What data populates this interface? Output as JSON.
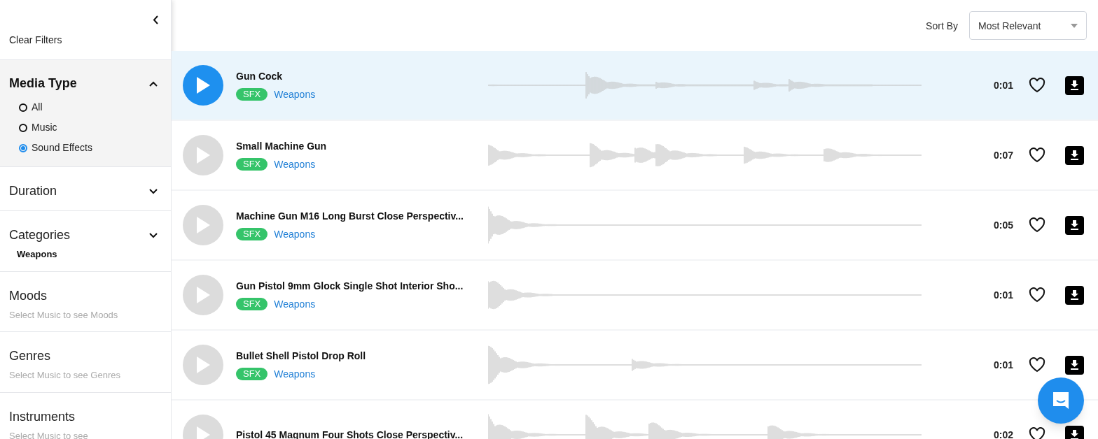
{
  "sidebar": {
    "clear_filters": "Clear Filters",
    "sections": [
      {
        "title": "Media Type",
        "expanded": true,
        "options": [
          {
            "label": "All",
            "selected": false
          },
          {
            "label": "Music",
            "selected": false
          },
          {
            "label": "Sound Effects",
            "selected": true
          }
        ]
      },
      {
        "title": "Duration",
        "expanded": false
      },
      {
        "title": "Categories",
        "expanded": false,
        "value": "Weapons"
      },
      {
        "title": "Moods",
        "hint": "Select Music to see Moods"
      },
      {
        "title": "Genres",
        "hint": "Select Music to see Genres"
      },
      {
        "title": "Instruments",
        "hint": "Select Music to see"
      }
    ]
  },
  "sort": {
    "label": "Sort By",
    "value": "Most Relevant"
  },
  "tracks": [
    {
      "title": "Gun Cock",
      "tag": "SFX",
      "category": "Weapons",
      "duration": "0:01",
      "selected": true
    },
    {
      "title": "Small Machine Gun",
      "tag": "SFX",
      "category": "Weapons",
      "duration": "0:07",
      "selected": false
    },
    {
      "title": "Machine Gun M16 Long Burst Close Perspectiv...",
      "tag": "SFX",
      "category": "Weapons",
      "duration": "0:05",
      "selected": false
    },
    {
      "title": "Gun Pistol 9mm Glock Single Shot Interior Sho...",
      "tag": "SFX",
      "category": "Weapons",
      "duration": "0:01",
      "selected": false
    },
    {
      "title": "Bullet Shell Pistol Drop Roll",
      "tag": "SFX",
      "category": "Weapons",
      "duration": "0:01",
      "selected": false
    },
    {
      "title": "Pistol 45 Magnum Four Shots Close Perspectiv...",
      "duration": "0:02",
      "selected": false
    }
  ]
}
